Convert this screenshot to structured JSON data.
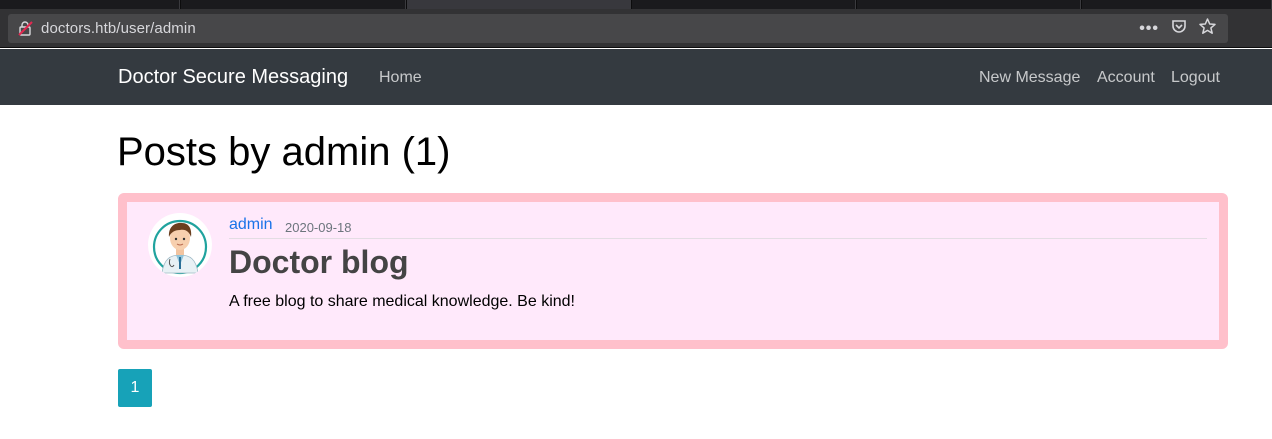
{
  "browser": {
    "url": "doctors.htb/user/admin",
    "icons": [
      "insecure-connection-icon",
      "page-actions-icon",
      "pocket-icon",
      "bookmark-star-icon"
    ]
  },
  "navbar": {
    "brand": "Doctor Secure Messaging",
    "home": "Home",
    "new_message": "New Message",
    "account": "Account",
    "logout": "Logout",
    "background_color": "#343a40"
  },
  "main": {
    "title": "Posts by admin (1)",
    "posts": [
      {
        "author": "admin",
        "date": "2020-09-18",
        "title": "Doctor blog",
        "content": "A free blog to share medical knowledge. Be kind!",
        "avatar": "doctor-avatar-icon"
      }
    ],
    "pagination": {
      "current": "1"
    }
  },
  "colors": {
    "card_border": "#ffc0cb",
    "card_background": "#ffe9fb",
    "link": "#1a73e8",
    "page_button": "#17a2b8"
  }
}
